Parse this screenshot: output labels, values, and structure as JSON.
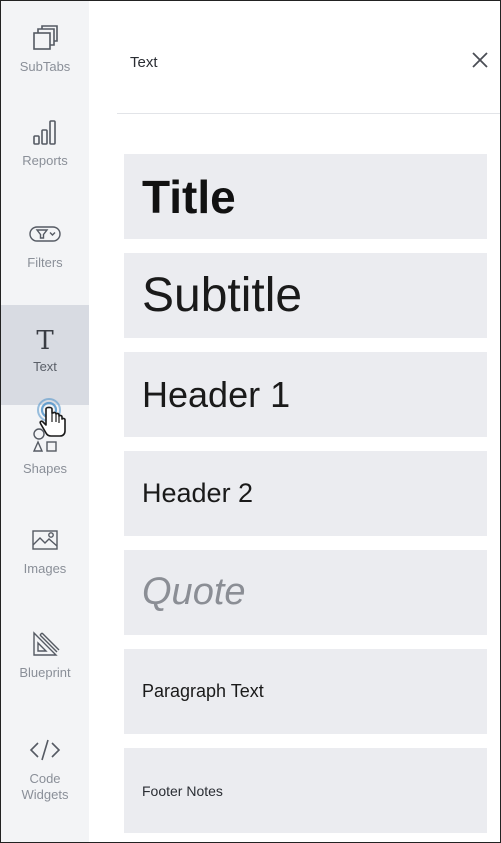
{
  "sidebar": {
    "items": [
      {
        "label": "SubTabs",
        "icon": "subtabs-icon"
      },
      {
        "label": "Reports",
        "icon": "reports-icon"
      },
      {
        "label": "Filters",
        "icon": "filters-icon"
      },
      {
        "label": "Text",
        "icon": "text-icon",
        "active": true
      },
      {
        "label": "Shapes",
        "icon": "shapes-icon"
      },
      {
        "label": "Images",
        "icon": "images-icon"
      },
      {
        "label": "Blueprint",
        "icon": "blueprint-icon"
      },
      {
        "label": "Code\nWidgets",
        "icon": "code-icon"
      }
    ]
  },
  "panel": {
    "title": "Text",
    "close_icon": "close-icon",
    "cards": [
      {
        "label": "Title"
      },
      {
        "label": "Subtitle"
      },
      {
        "label": "Header 1"
      },
      {
        "label": "Header 2"
      },
      {
        "label": "Quote"
      },
      {
        "label": "Paragraph Text"
      },
      {
        "label": "Footer Notes"
      }
    ]
  },
  "colors": {
    "sidebar_bg": "#f3f4f6",
    "sidebar_active_bg": "#d8dbe2",
    "card_bg": "#ebecf0",
    "quote_text": "#8b8e95",
    "pointer_accent": "#4a90c8"
  }
}
